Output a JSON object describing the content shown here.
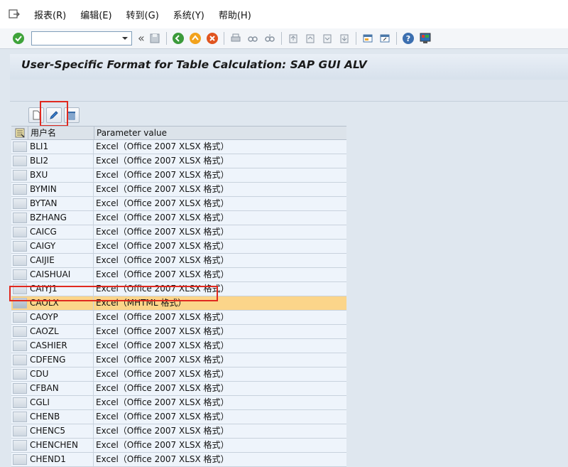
{
  "menu": {
    "items": [
      {
        "label": "报表(R)"
      },
      {
        "label": "编辑(E)"
      },
      {
        "label": "转到(G)"
      },
      {
        "label": "系统(Y)"
      },
      {
        "label": "帮助(H)"
      }
    ]
  },
  "toolbar": {
    "command_field": {
      "value": "",
      "placeholder": ""
    },
    "chevron": "«"
  },
  "page": {
    "title": "User-Specific Format for Table Calculation: SAP GUI ALV"
  },
  "grid": {
    "columns": [
      "用户名",
      "Parameter value"
    ],
    "rows": [
      {
        "user": "BLI1",
        "value": "Excel（Office 2007 XLSX 格式）"
      },
      {
        "user": "BLI2",
        "value": "Excel（Office 2007 XLSX 格式）"
      },
      {
        "user": "BXU",
        "value": "Excel（Office 2007 XLSX 格式）"
      },
      {
        "user": "BYMIN",
        "value": "Excel（Office 2007 XLSX 格式）"
      },
      {
        "user": "BYTAN",
        "value": "Excel（Office 2007 XLSX 格式）"
      },
      {
        "user": "BZHANG",
        "value": "Excel（Office 2007 XLSX 格式）"
      },
      {
        "user": "CAICG",
        "value": "Excel（Office 2007 XLSX 格式）"
      },
      {
        "user": "CAIGY",
        "value": "Excel（Office 2007 XLSX 格式）"
      },
      {
        "user": "CAIJIE",
        "value": "Excel（Office 2007 XLSX 格式）"
      },
      {
        "user": "CAISHUAI",
        "value": "Excel（Office 2007 XLSX 格式）"
      },
      {
        "user": "CAIYJ1",
        "value": "Excel（Office 2007 XLSX 格式）"
      },
      {
        "user": "CAOLX",
        "value": "Excel（MHTML 格式）",
        "selected": true
      },
      {
        "user": "CAOYP",
        "value": "Excel（Office 2007 XLSX 格式）"
      },
      {
        "user": "CAOZL",
        "value": "Excel（Office 2007 XLSX 格式）"
      },
      {
        "user": "CASHIER",
        "value": "Excel（Office 2007 XLSX 格式）"
      },
      {
        "user": "CDFENG",
        "value": "Excel（Office 2007 XLSX 格式）"
      },
      {
        "user": "CDU",
        "value": "Excel（Office 2007 XLSX 格式）"
      },
      {
        "user": "CFBAN",
        "value": "Excel（Office 2007 XLSX 格式）"
      },
      {
        "user": "CGLI",
        "value": "Excel（Office 2007 XLSX 格式）"
      },
      {
        "user": "CHENB",
        "value": "Excel（Office 2007 XLSX 格式）"
      },
      {
        "user": "CHENC5",
        "value": "Excel（Office 2007 XLSX 格式）"
      },
      {
        "user": "CHENCHEN",
        "value": "Excel（Office 2007 XLSX 格式）"
      },
      {
        "user": "CHEND1",
        "value": "Excel（Office 2007 XLSX 格式）"
      }
    ]
  },
  "colors": {
    "selected_row": "#fbd58a",
    "highlight": "#e0291f",
    "row_bg": "#eef4fb"
  }
}
